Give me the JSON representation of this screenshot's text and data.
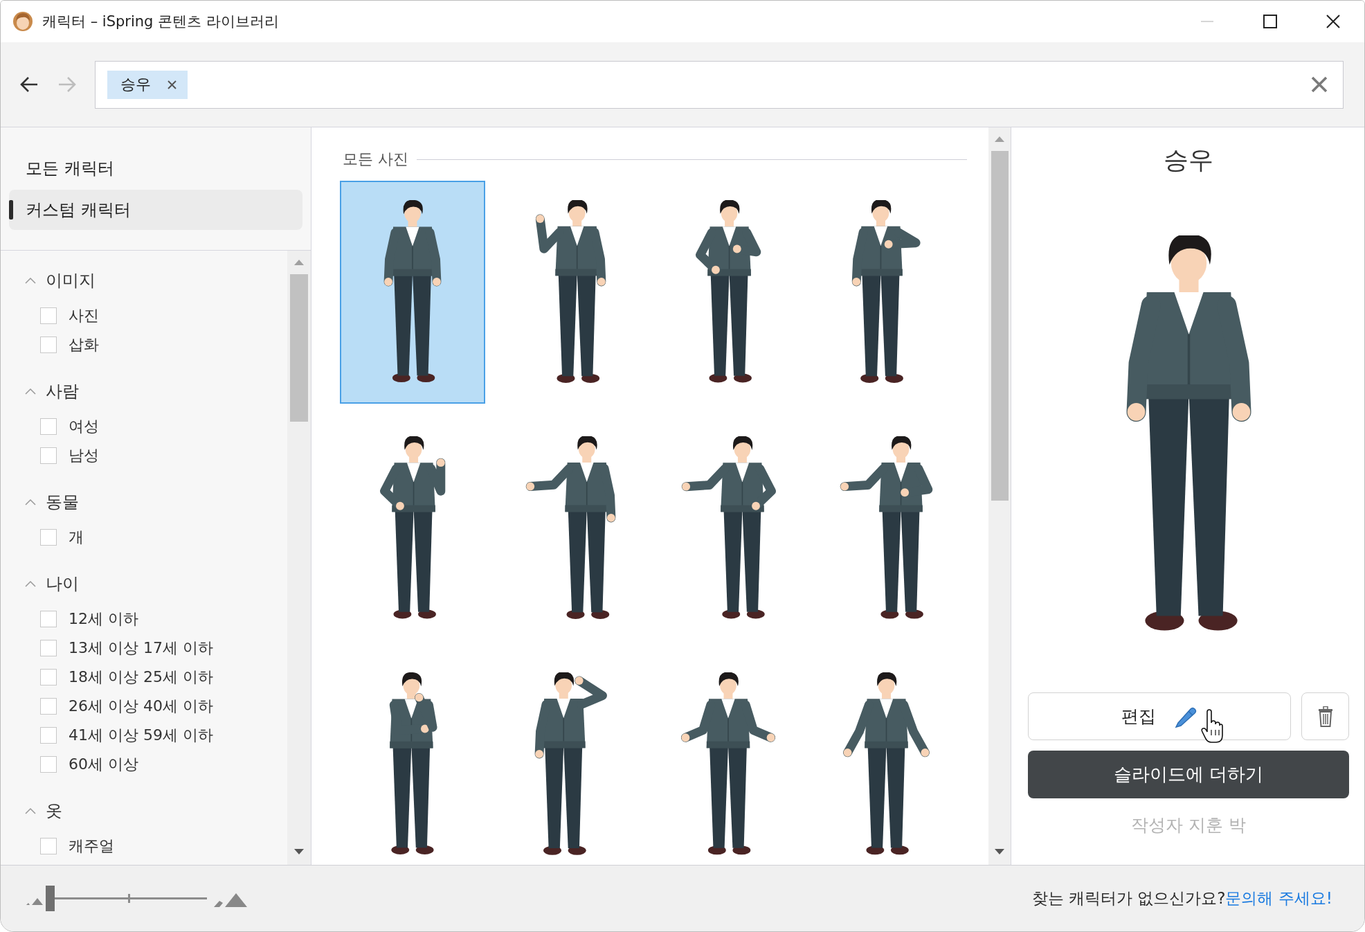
{
  "window": {
    "title": "캐릭터 – iSpring 콘텐츠 라이브러리",
    "controls": [
      {
        "kind": "minimize",
        "disabled": true
      },
      {
        "kind": "maximize",
        "disabled": false
      },
      {
        "kind": "close",
        "disabled": false
      }
    ]
  },
  "toolbar": {
    "navigation": [
      {
        "kind": "back",
        "disabled": false
      },
      {
        "kind": "forward",
        "disabled": true
      }
    ],
    "search": {
      "tags": [
        {
          "label": "승우"
        }
      ]
    }
  },
  "sidebar": {
    "categories": [
      {
        "label": "모든 캐릭터",
        "selected": false
      },
      {
        "label": "커스텀 캐릭터",
        "selected": true
      }
    ],
    "filters": [
      {
        "title": "이미지",
        "expanded": true,
        "options": [
          {
            "label": "사진",
            "checked": false
          },
          {
            "label": "삽화",
            "checked": false
          }
        ]
      },
      {
        "title": "사람",
        "expanded": true,
        "options": [
          {
            "label": "여성",
            "checked": false
          },
          {
            "label": "남성",
            "checked": false
          }
        ]
      },
      {
        "title": "동물",
        "expanded": true,
        "options": [
          {
            "label": "개",
            "checked": false
          }
        ]
      },
      {
        "title": "나이",
        "expanded": true,
        "options": [
          {
            "label": "12세 이하",
            "checked": false
          },
          {
            "label": "13세 이상 17세 이하",
            "checked": false
          },
          {
            "label": "18세 이상 25세 이하",
            "checked": false
          },
          {
            "label": "26세 이상 40세 이하",
            "checked": false
          },
          {
            "label": "41세 이상 59세 이하",
            "checked": false
          },
          {
            "label": "60세 이상",
            "checked": false
          }
        ]
      },
      {
        "title": "옷",
        "expanded": true,
        "options": [
          {
            "label": "캐주얼",
            "checked": false
          }
        ]
      }
    ]
  },
  "gallery": {
    "title": "모든 사진",
    "items": [
      {
        "kind": "standing",
        "selected": true
      },
      {
        "kind": "waving",
        "selected": false
      },
      {
        "kind": "thumbs-up",
        "selected": false
      },
      {
        "kind": "thumbs-down",
        "selected": false
      },
      {
        "kind": "pointing",
        "selected": false
      },
      {
        "kind": "presenting",
        "selected": false
      },
      {
        "kind": "presenting-hip",
        "selected": false
      },
      {
        "kind": "presenting-chest",
        "selected": false
      },
      {
        "kind": "thinking",
        "selected": false
      },
      {
        "kind": "head-scratch",
        "selected": false
      },
      {
        "kind": "shrugging",
        "selected": false
      },
      {
        "kind": "open-arms",
        "selected": false
      }
    ]
  },
  "details": {
    "name": "승우",
    "kind": "standing",
    "edit": "편집",
    "add": "슬라이드에 더하기",
    "author": "작성자 지훈 박"
  },
  "footer": {
    "zoom": {
      "level": 0
    },
    "prompt": "찾는 캐릭터가 없으신가요?",
    "link": "문의해 주세요!"
  }
}
